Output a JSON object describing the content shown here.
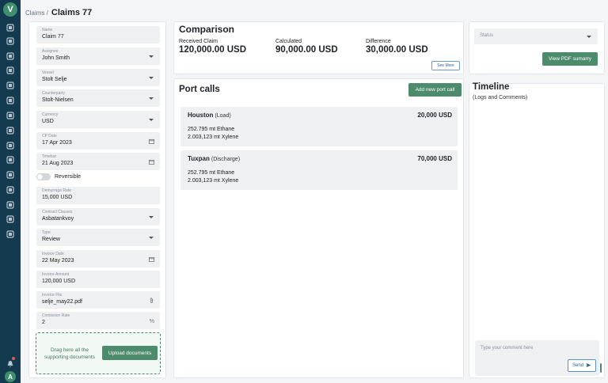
{
  "colors": {
    "nav_bg": "#143a4f",
    "accent_green": "#4c8b6c",
    "field_bg": "#eef0f2"
  },
  "nav": {
    "logo": "V",
    "icons": [
      "dashboard-icon",
      "briefcase-icon",
      "list-icon",
      "org-chart-icon",
      "globe-icon",
      "bar-chart-icon",
      "document-icon",
      "transfer-icon",
      "user-icon",
      "users-icon",
      "store-icon",
      "location-icon",
      "search-doc-icon",
      "table-icon",
      "tools-icon"
    ],
    "avatar_initial": "A"
  },
  "breadcrumb": {
    "parent": "Claims /",
    "current": "Claims 77"
  },
  "form": {
    "name": {
      "label": "Name",
      "value": "Claim 77"
    },
    "assignee": {
      "label": "Assignee",
      "value": "John Smith"
    },
    "vessel": {
      "label": "Vessel",
      "value": "Stolt Selje"
    },
    "counterparty": {
      "label": "Counterparty",
      "value": "Stolt-Nielsen"
    },
    "currency": {
      "label": "Currency",
      "value": "USD"
    },
    "cp_date": {
      "label": "CP Date",
      "value": "17 Apr 2023"
    },
    "timebar": {
      "label": "Timebar",
      "value": "21 Aug 2023"
    },
    "reversible_label": "Reversible",
    "demurrage_rate": {
      "label": "Demurrage Rate",
      "value": "15,000 USD"
    },
    "contract_clauses": {
      "label": "Contract Clauses",
      "value": "Asbatankvoy"
    },
    "type": {
      "label": "Type",
      "value": "Review"
    },
    "invoice_date": {
      "label": "Invoice Date",
      "value": "22 May 2023"
    },
    "invoice_amount": {
      "label": "Invoice Amount",
      "value": "120,000 USD"
    },
    "invoice_file": {
      "label": "Invoice File",
      "value": "selje_may22.pdf"
    },
    "commission_rate": {
      "label": "Comission Rate",
      "value": "2",
      "unit": "%"
    },
    "dropzone_text": "Drag here all the supporting documents",
    "upload_label": "Upload documents"
  },
  "comparison": {
    "title": "Comparison",
    "received": {
      "label": "Received Claim",
      "value": "120,000.00 USD"
    },
    "calculated": {
      "label": "Calculated",
      "value": "90,000.00 USD"
    },
    "difference": {
      "label": "Difference",
      "value": "30,000.00 USD"
    },
    "see_more": "See More"
  },
  "port_calls": {
    "title": "Port calls",
    "add_label": "Add new port call",
    "items": [
      {
        "port": "Houston",
        "kind": "(Load)",
        "amount": "20,000 USD",
        "cargo": [
          "252.795 mt Ethane",
          "2.003,123 mt Xylene"
        ]
      },
      {
        "port": "Tuxpan",
        "kind": "(Discharge)",
        "amount": "70,000 USD",
        "cargo": [
          "252.795 mt Ethane",
          "2.003,123 mt Xylene"
        ]
      }
    ]
  },
  "status": {
    "placeholder": "Status",
    "pdf_label": "View PDF sumarry"
  },
  "timeline": {
    "title": "Timeline",
    "subtitle": "(Logs and Comments)",
    "comment_placeholder": "Type your comment here",
    "send_label": "Send"
  }
}
